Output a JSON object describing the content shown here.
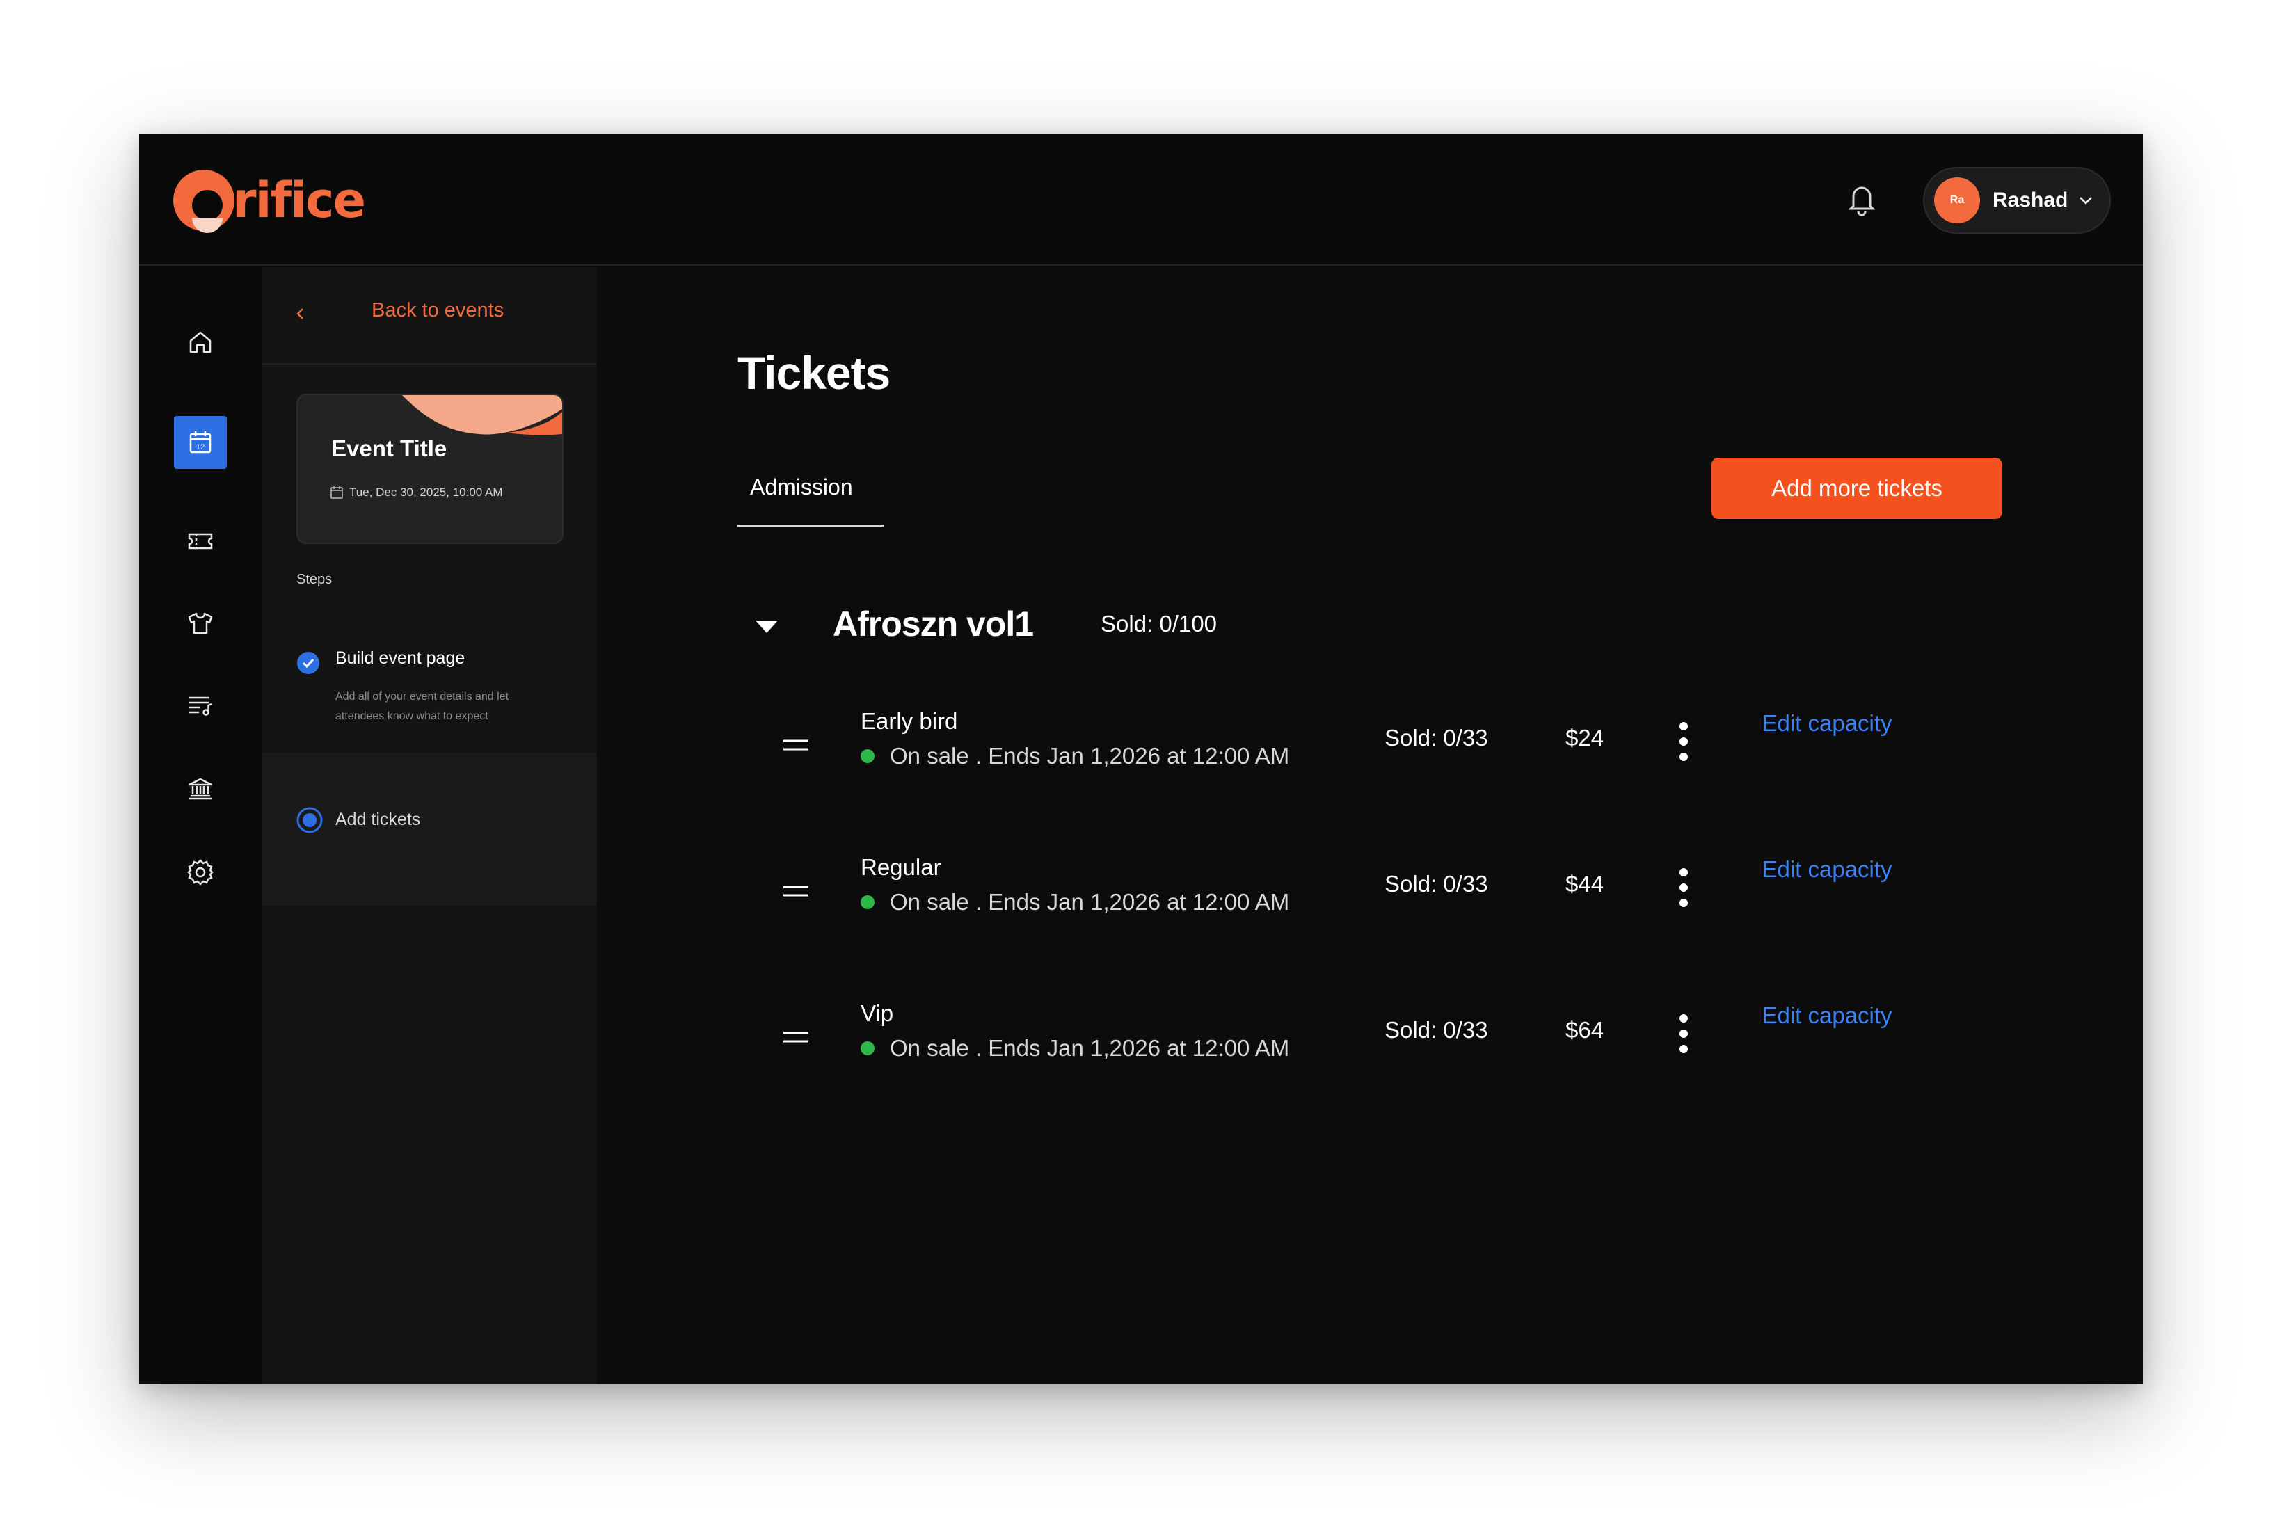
{
  "brand": {
    "name": "rifice",
    "accent": "#f26a3d"
  },
  "header": {
    "notification_icon": "bell-icon",
    "user": {
      "initials": "Ra",
      "name": "Rashad"
    }
  },
  "rail": {
    "items": [
      {
        "icon": "home-icon",
        "active": false
      },
      {
        "icon": "calendar-icon",
        "active": true,
        "badge": "12"
      },
      {
        "icon": "ticket-icon",
        "active": false
      },
      {
        "icon": "tshirt-icon",
        "active": false
      },
      {
        "icon": "playlist-icon",
        "active": false
      },
      {
        "icon": "bank-icon",
        "active": false
      },
      {
        "icon": "settings-icon",
        "active": false
      }
    ]
  },
  "steps_panel": {
    "back_label": "Back to events",
    "event": {
      "title": "Event Title",
      "date": "Tue, Dec 30, 2025, 10:00 AM"
    },
    "steps_label": "Steps",
    "steps": [
      {
        "title": "Build event page",
        "description": "Add all of your event details and let attendees know what to expect",
        "status": "completed"
      },
      {
        "title": "Add tickets",
        "status": "current"
      }
    ]
  },
  "main": {
    "title": "Tickets",
    "tabs": [
      {
        "label": "Admission",
        "active": true
      }
    ],
    "add_button": "Add more tickets",
    "group": {
      "name": "Afroszn vol1",
      "sold": "Sold:  0/100",
      "tickets": [
        {
          "name": "Early bird",
          "status": "On sale . Ends Jan 1,2026 at 12:00 AM",
          "sold": "Sold:  0/33",
          "price": "$24",
          "edit": "Edit capacity"
        },
        {
          "name": "Regular",
          "status": "On sale . Ends Jan 1,2026 at 12:00 AM",
          "sold": "Sold:  0/33",
          "price": "$44",
          "edit": "Edit capacity"
        },
        {
          "name": "Vip",
          "status": "On sale . Ends Jan 1,2026 at 12:00 AM",
          "sold": "Sold:  0/33",
          "price": "$64",
          "edit": "Edit capacity"
        }
      ]
    }
  }
}
